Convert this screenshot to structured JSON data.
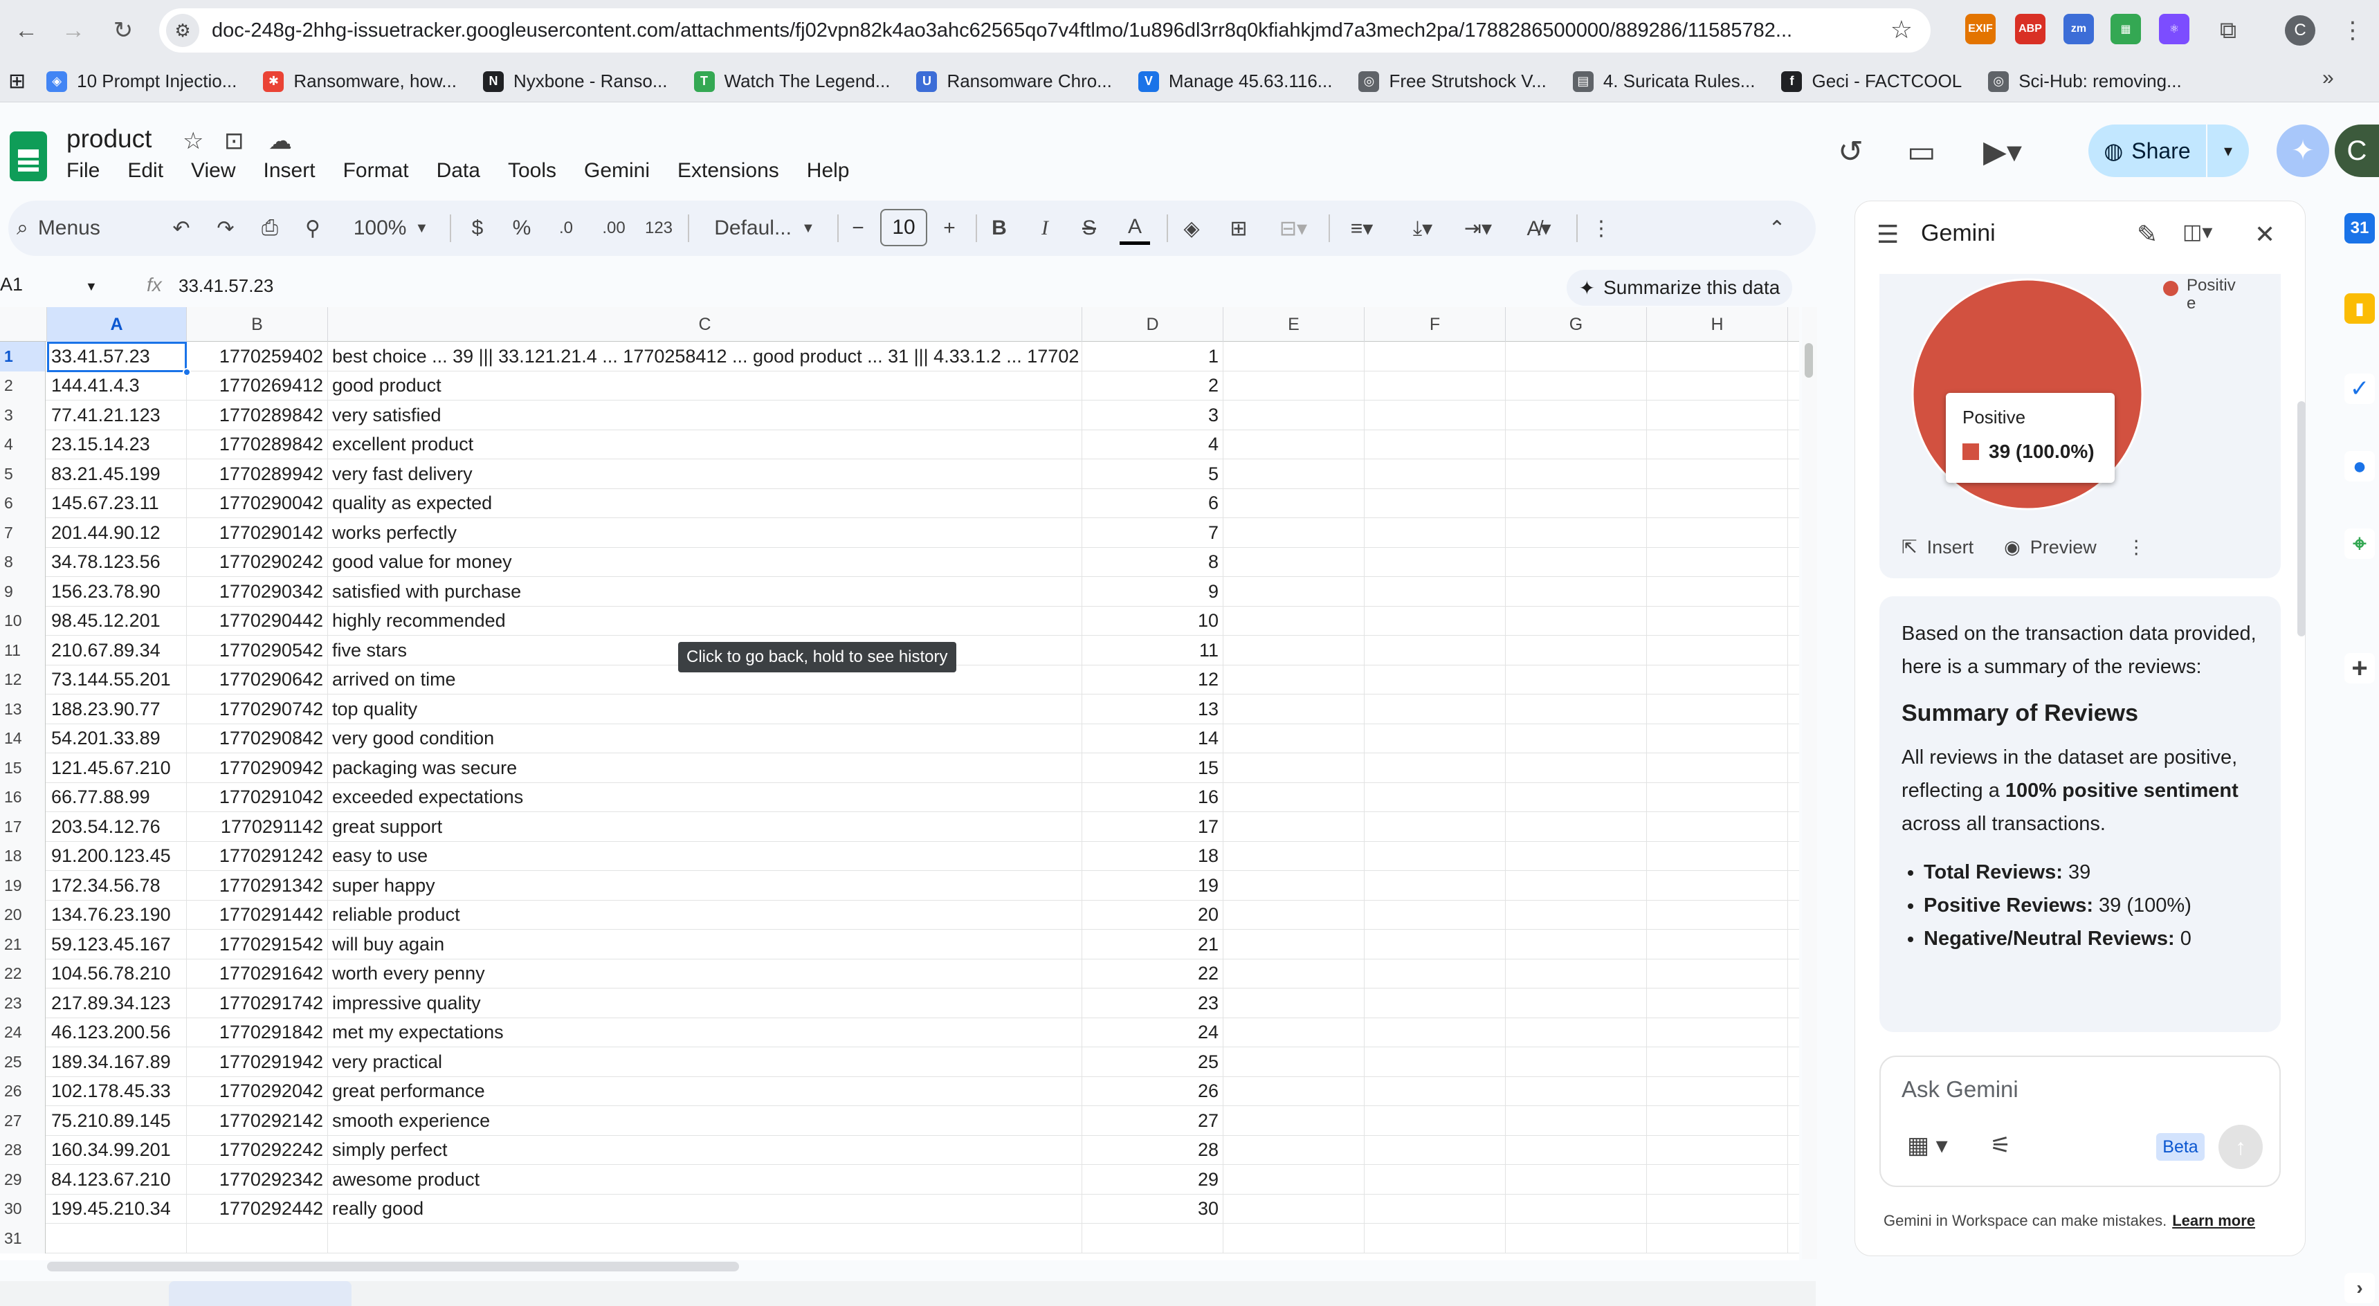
{
  "browser": {
    "url": "doc-248g-2hhg-issuetracker.googleusercontent.com/attachments/fj02vpn82k4ao3ahc62565qo7v4ftlmo/1u896dl3rr8q0kfiahkjmd7a3mech2pa/1788286500000/889286/11585782...",
    "extensions": [
      {
        "label": "EXIF",
        "color": "#e37400"
      },
      {
        "label": "ABP",
        "color": "#d93025"
      },
      {
        "label": "zm",
        "color": "#3c6dd7"
      },
      {
        "label": "▦",
        "color": "#34a853"
      },
      {
        "label": "⚛",
        "color": "#7c4dff"
      }
    ],
    "bookmarks": [
      {
        "label": "10 Prompt Injectio...",
        "color": "#4285f4",
        "glyph": "◈"
      },
      {
        "label": "Ransomware, how...",
        "color": "#ea4335",
        "glyph": "✱"
      },
      {
        "label": "Nyxbone - Ranso...",
        "color": "#202124",
        "glyph": "N"
      },
      {
        "label": "Watch The Legend...",
        "color": "#34a853",
        "glyph": "T"
      },
      {
        "label": "Ransomware Chro...",
        "color": "#3c6dd7",
        "glyph": "U"
      },
      {
        "label": "Manage 45.63.116...",
        "color": "#1a73e8",
        "glyph": "V"
      },
      {
        "label": "Free Strutshock V...",
        "color": "#5f6368",
        "glyph": "◎"
      },
      {
        "label": "4. Suricata Rules...",
        "color": "#5f6368",
        "glyph": "▤"
      },
      {
        "label": "Geci - FACTCOOL",
        "color": "#202124",
        "glyph": "f"
      },
      {
        "label": "Sci-Hub: removing...",
        "color": "#5f6368",
        "glyph": "◎"
      }
    ]
  },
  "doc": {
    "title": "product",
    "menus": [
      "File",
      "Edit",
      "View",
      "Insert",
      "Format",
      "Data",
      "Tools",
      "Gemini",
      "Extensions",
      "Help"
    ],
    "share_label": "Share",
    "avatar_letter": "C"
  },
  "toolbar": {
    "search_label": "Menus",
    "zoom": "100%",
    "currency": "$",
    "percent": "%",
    "dec_decrease": ".0",
    "dec_increase": ".00",
    "number_format": "123",
    "font": "Defaul...",
    "font_size": "10"
  },
  "formula_bar": {
    "cell_ref": "A1",
    "fx": "fx",
    "value": "33.41.57.23",
    "summarize_label": "Summarize this data"
  },
  "grid": {
    "columns": [
      "A",
      "B",
      "C",
      "D",
      "E",
      "F",
      "G",
      "H"
    ],
    "selected_column": "A",
    "rows": [
      [
        "33.41.57.23",
        "1770259402",
        "best choice ... 39 ||| 33.121.21.4 ... 1770258412 ... good product ... 31 ||| 4.33.1.2 ... 17702",
        "1"
      ],
      [
        "144.41.4.3",
        "1770269412",
        "good product",
        "2"
      ],
      [
        "77.41.21.123",
        "1770289842",
        "very satisfied",
        "3"
      ],
      [
        "23.15.14.23",
        "1770289842",
        "excellent product",
        "4"
      ],
      [
        "83.21.45.199",
        "1770289942",
        "very fast delivery",
        "5"
      ],
      [
        "145.67.23.11",
        "1770290042",
        "quality as expected",
        "6"
      ],
      [
        "201.44.90.12",
        "1770290142",
        "works perfectly",
        "7"
      ],
      [
        "34.78.123.56",
        "1770290242",
        "good value for money",
        "8"
      ],
      [
        "156.23.78.90",
        "1770290342",
        "satisfied with purchase",
        "9"
      ],
      [
        "98.45.12.201",
        "1770290442",
        "highly recommended",
        "10"
      ],
      [
        "210.67.89.34",
        "1770290542",
        "five stars",
        "11"
      ],
      [
        "73.144.55.201",
        "1770290642",
        "arrived on time",
        "12"
      ],
      [
        "188.23.90.77",
        "1770290742",
        "top quality",
        "13"
      ],
      [
        "54.201.33.89",
        "1770290842",
        "very good condition",
        "14"
      ],
      [
        "121.45.67.210",
        "1770290942",
        "packaging was secure",
        "15"
      ],
      [
        "66.77.88.99",
        "1770291042",
        "exceeded expectations",
        "16"
      ],
      [
        "203.54.12.76",
        "1770291142",
        "great support",
        "17"
      ],
      [
        "91.200.123.45",
        "1770291242",
        "easy to use",
        "18"
      ],
      [
        "172.34.56.78",
        "1770291342",
        "super happy",
        "19"
      ],
      [
        "134.76.23.190",
        "1770291442",
        "reliable product",
        "20"
      ],
      [
        "59.123.45.167",
        "1770291542",
        "will buy again",
        "21"
      ],
      [
        "104.56.78.210",
        "1770291642",
        "worth every penny",
        "22"
      ],
      [
        "217.89.34.123",
        "1770291742",
        "impressive quality",
        "23"
      ],
      [
        "46.123.200.56",
        "1770291842",
        "met my expectations",
        "24"
      ],
      [
        "189.34.167.89",
        "1770291942",
        "very practical",
        "25"
      ],
      [
        "102.178.45.33",
        "1770292042",
        "great performance",
        "26"
      ],
      [
        "75.210.89.145",
        "1770292142",
        "smooth experience",
        "27"
      ],
      [
        "160.34.99.201",
        "1770292242",
        "simply perfect",
        "28"
      ],
      [
        "84.123.67.210",
        "1770292342",
        "awesome product",
        "29"
      ],
      [
        "199.45.210.34",
        "1770292442",
        "really good",
        "30"
      ],
      [
        "",
        "",
        "",
        ""
      ]
    ],
    "tooltip": "Click to go back, hold to see history"
  },
  "gemini": {
    "title": "Gemini",
    "chart_data": {
      "type": "pie",
      "slices": [
        {
          "name": "Positive",
          "value": 39,
          "percent": 100.0,
          "color": "#d25140"
        }
      ],
      "legend": [
        "Positiv e"
      ],
      "tooltip_title": "Positive",
      "tooltip_value": "39 (100.0%)"
    },
    "chart_actions": {
      "insert": "Insert",
      "preview": "Preview"
    },
    "summary": {
      "intro": "Based on the transaction data provided, here is a summary of the reviews:",
      "heading": "Summary of Reviews",
      "para_before": "All reviews in the dataset are positive, reflecting a ",
      "para_bold": "100% positive sentiment",
      "para_after": " across all transactions.",
      "bullets": [
        {
          "label": "Total Reviews:",
          "value": " 39"
        },
        {
          "label": "Positive Reviews:",
          "value": " 39 (100%)"
        },
        {
          "label": "Negative/Neutral Reviews:",
          "value": " 0"
        }
      ]
    },
    "ask_placeholder": "Ask Gemini",
    "beta": "Beta",
    "disclaimer": "Gemini in Workspace can make mistakes.",
    "learn_more": "Learn more"
  }
}
